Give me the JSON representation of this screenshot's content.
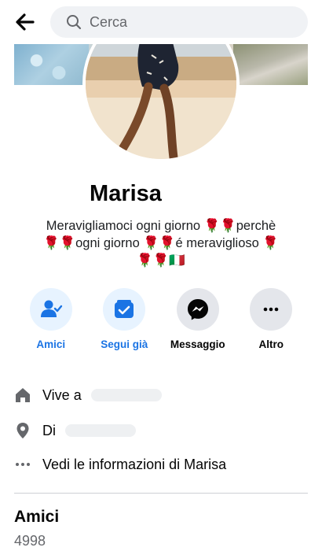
{
  "header": {
    "search_placeholder": "Cerca"
  },
  "profile": {
    "name": "Marisa",
    "bio_line1": "Meravigliamoci ogni giorno 🌹🌹perchè",
    "bio_line2": "🌹🌹ogni giorno 🌹🌹é meraviglioso 🌹",
    "bio_line3": "🌹🌹🇮🇹"
  },
  "actions": [
    {
      "label": "Amici",
      "icon": "friends-check-icon",
      "active": true
    },
    {
      "label": "Segui già",
      "icon": "follow-check-icon",
      "active": true
    },
    {
      "label": "Messaggio",
      "icon": "messenger-icon",
      "active": false
    },
    {
      "label": "Altro",
      "icon": "more-icon",
      "active": false
    }
  ],
  "intro": {
    "lives_in": "Vive a",
    "from": "Di",
    "see_info": "Vedi le informazioni di Marisa"
  },
  "friends": {
    "title": "Amici",
    "count": "4998"
  },
  "colors": {
    "accent_blue": "#1b74e4",
    "accent_blue_bg": "#e7f3ff",
    "icon_grey": "#65676b"
  }
}
